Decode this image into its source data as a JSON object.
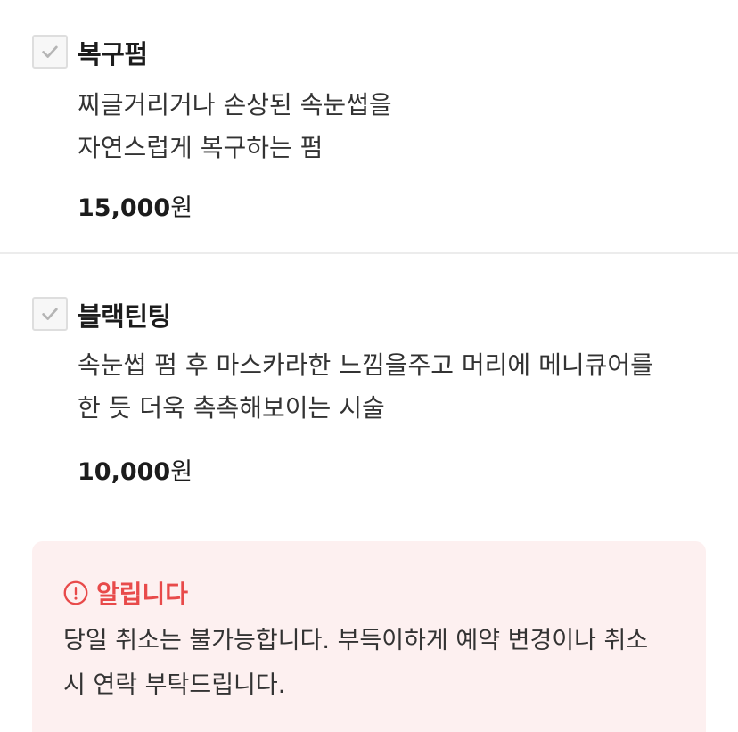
{
  "options": [
    {
      "title": "복구펌",
      "description_lines": [
        "찌글거리거나 손상된 속눈썹을",
        "자연스럽게 복구하는 펌"
      ],
      "price_amount": "15,000",
      "price_unit": "원",
      "checked": false
    },
    {
      "title": "블랙틴팅",
      "description_lines": [
        "속눈썹 펌 후 마스카라한 느낌을주고 머리에 메니큐어를",
        "한 듯 더욱 촉촉해보이는 시술"
      ],
      "price_amount": "10,000",
      "price_unit": "원",
      "checked": false
    }
  ],
  "notice": {
    "icon": "alert-circle-icon",
    "title": "알립니다",
    "body_lines": [
      "당일 취소는 불가능합니다. 부득이하게 예약 변경이나 취소",
      "시 연락 부탁드립니다."
    ]
  },
  "colors": {
    "notice_accent": "#e84a4a",
    "notice_background": "#fdf0f0",
    "checkbox_border": "#dedede",
    "checkmark": "#b5b5b5"
  }
}
